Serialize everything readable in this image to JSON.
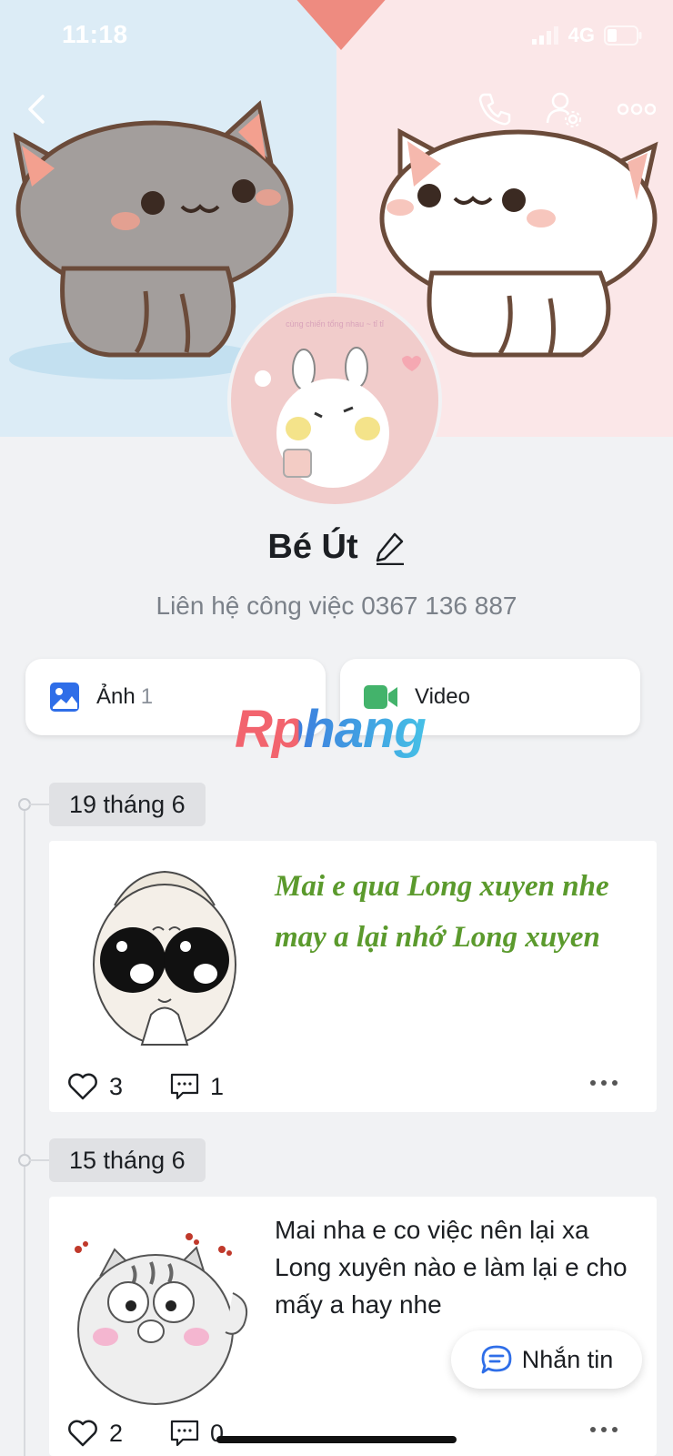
{
  "status_bar": {
    "time": "11:18",
    "network": "4G"
  },
  "profile": {
    "name": "Bé Út",
    "bio": "Liên hệ công việc 0367 136 887",
    "avatar_caption": "cùng chiến tổng nhau ~ tỉ tỉ"
  },
  "media": {
    "photos": {
      "label": "Ảnh",
      "count": "1"
    },
    "videos": {
      "label": "Video"
    }
  },
  "watermark": "Rphang",
  "timeline": [
    {
      "date": "19 tháng 6",
      "text": "Mai e qua Long xuyen nhe may a lại nhớ Long xuyen",
      "likes": "3",
      "comments": "1"
    },
    {
      "date": "15 tháng 6",
      "text": "Mai nha e co việc nên lại xa Long xuyên nào e làm lại e cho mấy a hay nhe",
      "likes": "2",
      "comments": "0"
    }
  ],
  "message_button": {
    "label": "Nhắn tin"
  },
  "icons": {
    "back": "chevron-left-icon",
    "call": "phone-icon",
    "settings": "user-settings-icon",
    "more": "more-dots-icon",
    "photos": "image-icon",
    "videos": "video-camera-icon",
    "like": "heart-icon",
    "comment": "comment-icon",
    "edit": "pencil-icon",
    "message": "chat-bubble-icon"
  },
  "colors": {
    "photo_icon": "#2f6ee8",
    "video_icon": "#43b36b",
    "post_text_green": "#5b9a2d",
    "message_icon": "#2f6ee8"
  }
}
